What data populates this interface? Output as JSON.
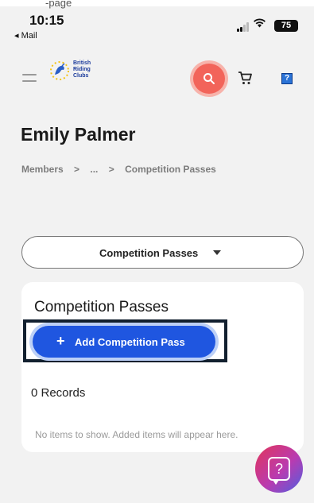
{
  "status_bar": {
    "time": "10:15",
    "back_app": "Mail",
    "battery": "75",
    "icons": [
      "signal-icon",
      "wifi-icon",
      "battery-icon"
    ]
  },
  "browser": {
    "top_label": "-page"
  },
  "header": {
    "logo_text": "British Riding Clubs",
    "icons": [
      "menu-icon",
      "search-icon",
      "cart-icon",
      "help-icon"
    ],
    "help_label": "?",
    "colors": {
      "search": "#f2645a",
      "brand_blue": "#1c3c9c"
    }
  },
  "page": {
    "title": "Emily Palmer",
    "breadcrumb": [
      "Members",
      ">",
      "...",
      ">",
      "Competition Passes"
    ]
  },
  "dropdown": {
    "selected": "Competition Passes"
  },
  "card": {
    "title": "Competition Passes",
    "add_button_icon": "+",
    "add_button_label": "Add Competition Pass",
    "records": "0 Records",
    "empty_text": "No items to show. Added items will appear here.",
    "colors": {
      "primary": "#1f56e0"
    }
  },
  "help_fab": {
    "label": "?",
    "icon": "help-chat-icon"
  }
}
